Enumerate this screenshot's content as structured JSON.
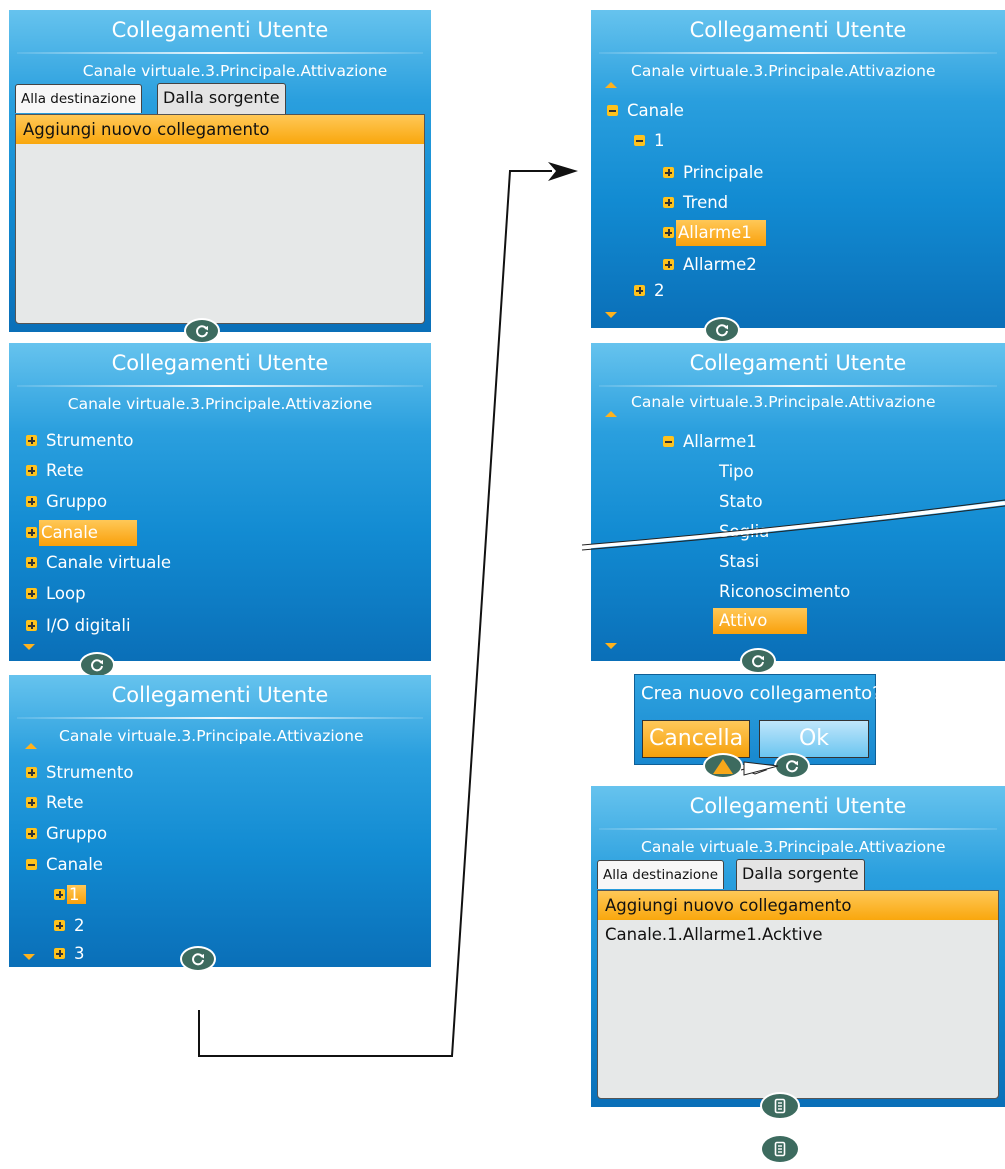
{
  "title": "Collegamenti Utente",
  "path": "Canale virtuale.3.Principale.Attivazione",
  "tabs": {
    "destination": "Alla destinazione",
    "source": "Dalla sorgente"
  },
  "add_link": "Aggiungi nuovo collegamento",
  "top_level_items": [
    "Strumento",
    "Rete",
    "Gruppo",
    "Canale",
    "Canale virtuale",
    "Loop",
    "I/O digitali"
  ],
  "channel_items": [
    "1",
    "2",
    "3"
  ],
  "channel1_items": [
    "Principale",
    "Trend",
    "Allarme1",
    "Allarme2"
  ],
  "alarm_items": [
    "Tipo",
    "Stato",
    "Soglia",
    "Stasi",
    "Riconoscimento",
    "Attivo"
  ],
  "alarm_label": "Allarme1",
  "canale_label": "Canale",
  "channel1_label": "1",
  "channel2_label": "2",
  "dialog": {
    "message": "Crea nuovo collegamento?",
    "cancel": "Cancella",
    "ok": "Ok"
  },
  "new_link": "Canale.1.Allarme1.Acktive",
  "icons": {
    "rotate": "rotate-icon",
    "document": "document-icon"
  },
  "colors": {
    "highlight": "#f9a70d",
    "panel": "#128bd2",
    "button": "#3d6b5f"
  }
}
